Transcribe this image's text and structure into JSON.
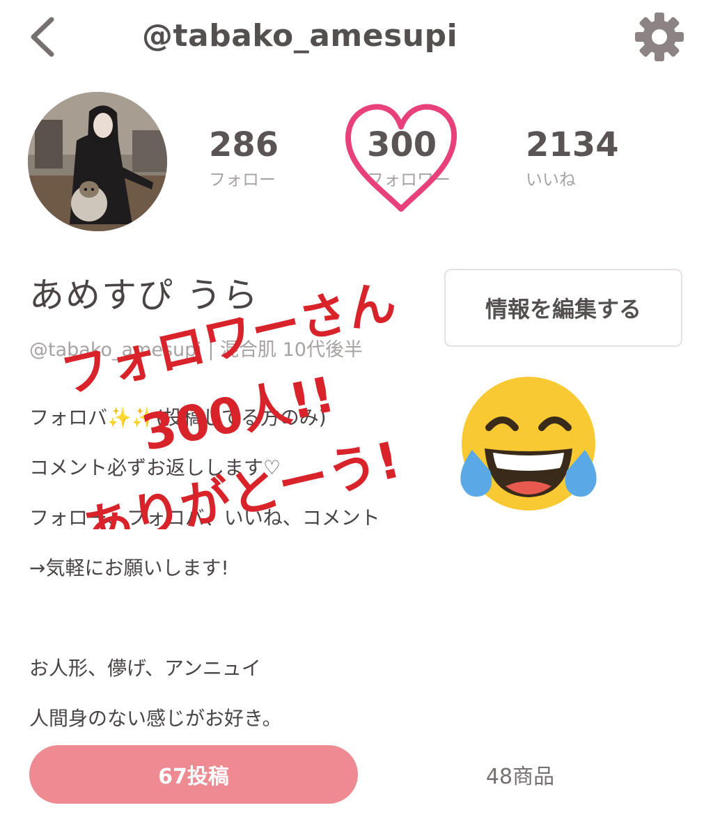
{
  "header": {
    "title": "@tabako_amesupi",
    "back_icon": "chevron-left-icon",
    "settings_icon": "gear-icon"
  },
  "profile": {
    "display_name": "あめすぴ うら",
    "subline": "@tabako_amesupi | 混合肌 10代後半",
    "edit_button_label": "情報を編集する"
  },
  "stats": [
    {
      "value": "286",
      "label": "フォロー"
    },
    {
      "value": "300",
      "label": "フォロワー"
    },
    {
      "value": "2134",
      "label": "いいね"
    }
  ],
  "bio": [
    "フォロバ✨✨(投稿してる方のみ)",
    "コメント必ずお返しします♡",
    "フォロー、フォロバ、いいね、コメント",
    "→気軽にお願いします!",
    "",
    "お人形、儚げ、アンニュイ",
    "人間身のない感じがお好き。"
  ],
  "overlay": {
    "line1": "フォロワーさん",
    "line2": "300人!!",
    "line3": "ありがとーう!",
    "emoji": "tears-of-joy-emoji",
    "heart": "heart-outline-icon"
  },
  "tabs": {
    "posts": "67投稿",
    "items": "48商品"
  },
  "colors": {
    "accent_pink": "#ee8a92",
    "heart": "#e8407a",
    "handwriting": "#d8232a"
  }
}
